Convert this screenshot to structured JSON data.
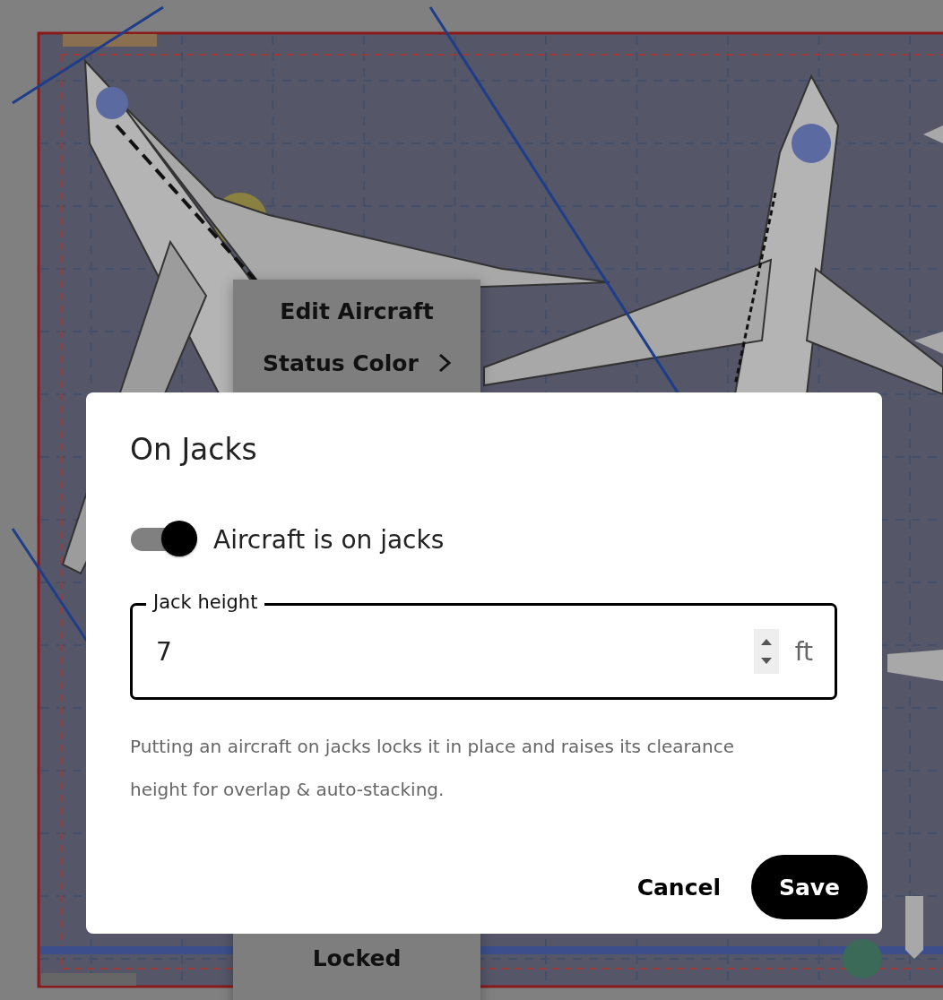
{
  "context_menu": {
    "items": [
      {
        "label": "Edit Aircraft",
        "kind": "action"
      },
      {
        "label": "Status Color",
        "kind": "submenu"
      },
      {
        "label": "Locked",
        "kind": "action"
      }
    ]
  },
  "dialog": {
    "title": "On Jacks",
    "toggle": {
      "label": "Aircraft is on jacks",
      "on": true
    },
    "field": {
      "label": "Jack height",
      "value": "7",
      "unit": "ft"
    },
    "help": "Putting an aircraft on jacks locks it in place and raises its clearance height for overlap & auto-stacking.",
    "buttons": [
      {
        "label": "Cancel",
        "kind": "text"
      },
      {
        "label": "Save",
        "kind": "primary"
      }
    ]
  }
}
